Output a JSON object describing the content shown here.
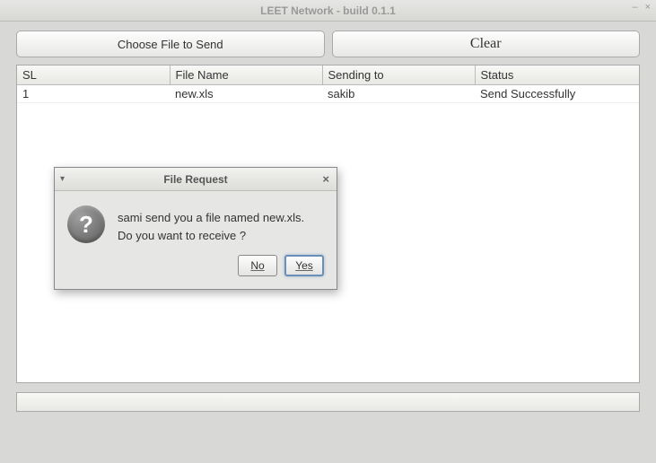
{
  "window": {
    "title": "LEET Network - build 0.1.1"
  },
  "buttons": {
    "choose_file": "Choose File to Send",
    "clear": "Clear"
  },
  "table": {
    "headers": {
      "sl": "SL",
      "file_name": "File Name",
      "sending_to": "Sending to",
      "status": "Status"
    },
    "rows": [
      {
        "sl": "1",
        "file_name": "new.xls",
        "sending_to": "sakib",
        "status": "Send Successfully"
      }
    ]
  },
  "dialog": {
    "title": "File Request",
    "message_line1": "sami send you a file named new.xls.",
    "message_line2": "Do you want to receive ?",
    "no": "No",
    "yes": "Yes"
  }
}
